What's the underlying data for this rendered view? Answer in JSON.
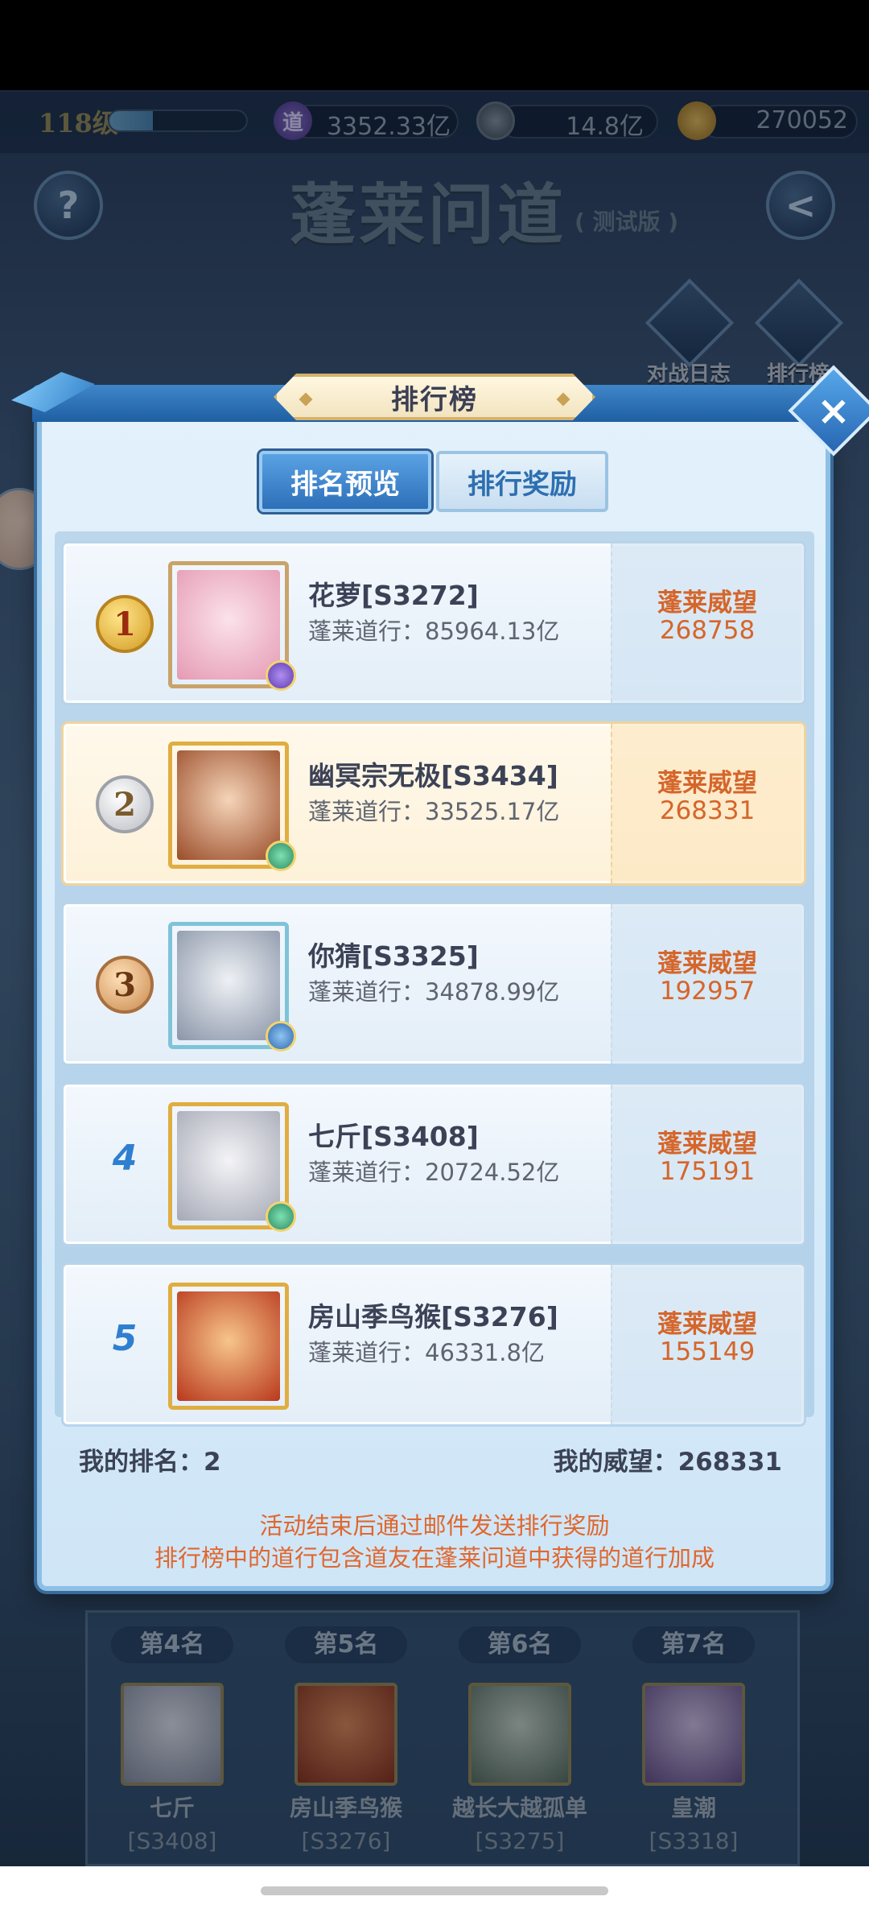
{
  "status_bar": {},
  "resources": {
    "level": "118级",
    "exp_progress": 0.32,
    "dao_icon": "道",
    "dao_value": "3352.33亿",
    "coin_value": "14.8亿",
    "gold_value": "270052"
  },
  "page": {
    "title": "蓬莱问道",
    "title_tag": "( 测试版 )",
    "help_icon": "?",
    "back_icon": "<",
    "battle_log_label": "对战日志",
    "ranking_label": "排行榜"
  },
  "modal": {
    "title": "排行榜",
    "close_icon": "×",
    "tabs": [
      {
        "label": "排名预览",
        "active": true
      },
      {
        "label": "排行奖励",
        "active": false
      }
    ],
    "prestige_label": "蓬莱威望",
    "entries": [
      {
        "rank": "1",
        "name": "花萝[S3272]",
        "power": "蓬莱道行：85964.13亿",
        "prestige": "268758",
        "highlight": false
      },
      {
        "rank": "2",
        "name": "幽冥宗无极[S3434]",
        "power": "蓬莱道行：33525.17亿",
        "prestige": "268331",
        "highlight": true
      },
      {
        "rank": "3",
        "name": "你猜[S3325]",
        "power": "蓬莱道行：34878.99亿",
        "prestige": "192957",
        "highlight": false
      },
      {
        "rank": "4",
        "name": "七斤[S3408]",
        "power": "蓬莱道行：20724.52亿",
        "prestige": "175191",
        "highlight": false
      },
      {
        "rank": "5",
        "name": "房山季鸟猴[S3276]",
        "power": "蓬莱道行：46331.8亿",
        "prestige": "155149",
        "highlight": false
      }
    ],
    "my_rank": "我的排名：2",
    "my_prestige": "我的威望：268331",
    "note_1": "活动结束后通过邮件发送排行奖励",
    "note_2": "排行榜中的道行包含道友在蓬莱问道中获得的道行加成"
  },
  "preview": [
    {
      "rank": "第4名",
      "name": "七斤",
      "server": "[S3408]"
    },
    {
      "rank": "第5名",
      "name": "房山季鸟猴",
      "server": "[S3276]"
    },
    {
      "rank": "第6名",
      "name": "越长大越孤单",
      "server": "[S3275]"
    },
    {
      "rank": "第7名",
      "name": "皇潮",
      "server": "[S3318]"
    }
  ],
  "colors": {
    "accent": "#2d6fb8",
    "prestige_text": "#d5662b",
    "highlight_card": "#fdf1d8"
  }
}
